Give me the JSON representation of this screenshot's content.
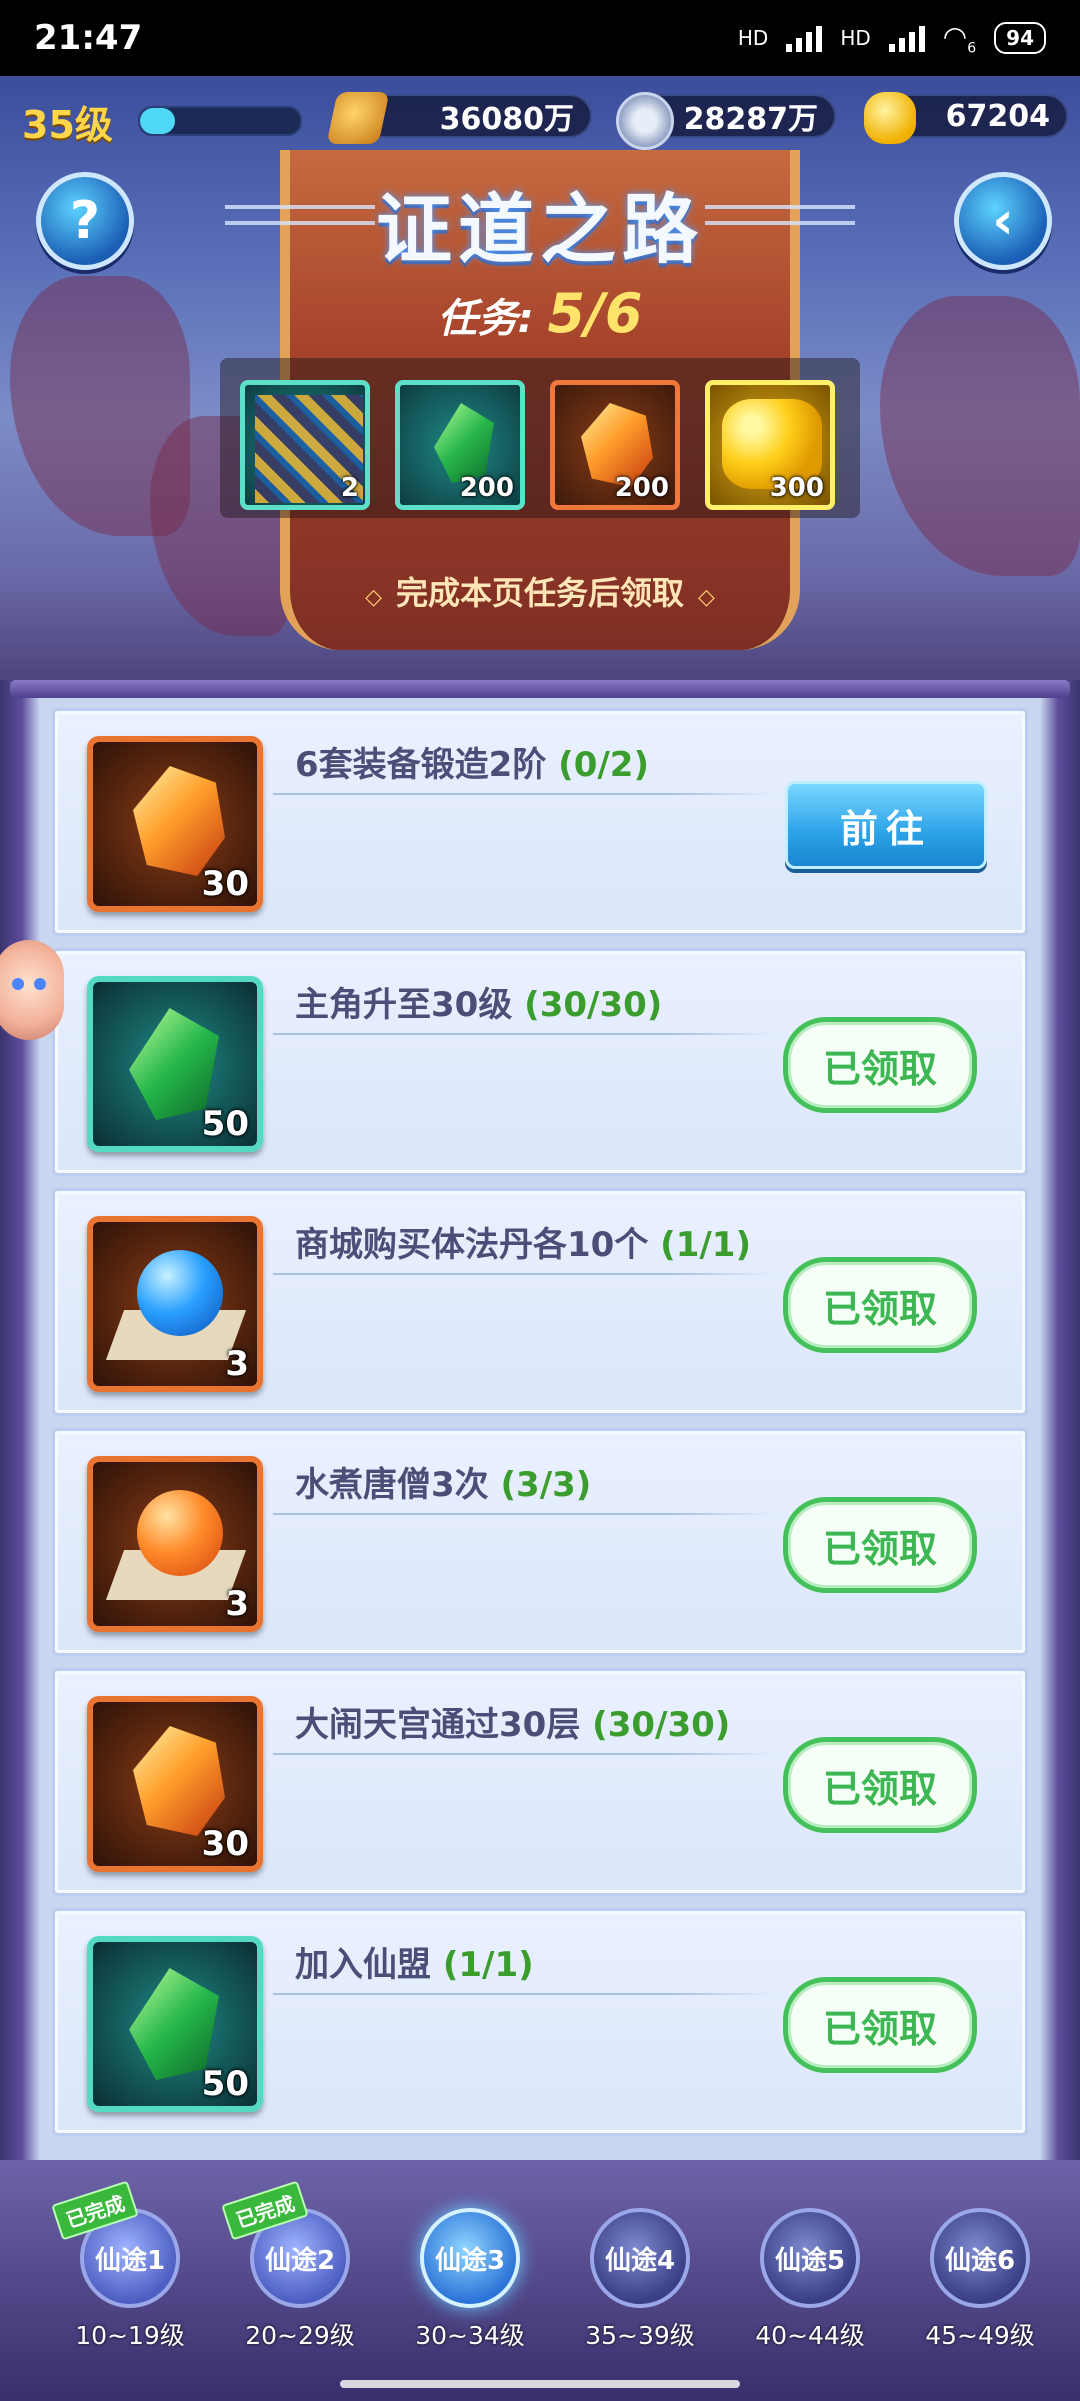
{
  "status_bar": {
    "time": "21:47",
    "hd1": "HD",
    "hd2": "HD",
    "wifi_sub": "6",
    "battery": "94"
  },
  "player": {
    "level": "35级"
  },
  "resources": {
    "power": "36080万",
    "coins": "28287万",
    "gold": "67204"
  },
  "header": {
    "title": "证道之路",
    "task_label": "任务:",
    "task_progress": "5/6",
    "claim_hint": "完成本页任务后领取"
  },
  "rewards": [
    {
      "icon": "armor-set-icon",
      "count": "2"
    },
    {
      "icon": "green-gem-icon",
      "count": "200"
    },
    {
      "icon": "orange-stone-icon",
      "count": "200"
    },
    {
      "icon": "gold-ingot-icon",
      "count": "300"
    }
  ],
  "tasks": [
    {
      "name": "6套装备锻造2阶",
      "progress": "(0/2)",
      "reward_icon": "orange-stone-icon",
      "reward_count": "30",
      "button": "前往",
      "state": "go"
    },
    {
      "name": "主角升至30级",
      "progress": "(30/30)",
      "reward_icon": "green-gem-icon",
      "reward_count": "50",
      "button": "已领取",
      "state": "claimed"
    },
    {
      "name": "商城购买体法丹各10个",
      "progress": "(1/1)",
      "reward_icon": "blue-pill-icon",
      "reward_count": "3",
      "button": "已领取",
      "state": "claimed"
    },
    {
      "name": "水煮唐僧3次",
      "progress": "(3/3)",
      "reward_icon": "orange-pill-icon",
      "reward_count": "3",
      "button": "已领取",
      "state": "claimed"
    },
    {
      "name": "大闹天宫通过30层",
      "progress": "(30/30)",
      "reward_icon": "orange-stone-icon",
      "reward_count": "30",
      "button": "已领取",
      "state": "claimed"
    },
    {
      "name": "加入仙盟",
      "progress": "(1/1)",
      "reward_icon": "green-gem-icon",
      "reward_count": "50",
      "button": "已领取",
      "state": "claimed"
    }
  ],
  "nav": [
    {
      "label": "仙途1",
      "range": "10~19级",
      "tag": "已完成"
    },
    {
      "label": "仙途2",
      "range": "20~29级",
      "tag": "已完成"
    },
    {
      "label": "仙途3",
      "range": "30~34级",
      "tag": ""
    },
    {
      "label": "仙途4",
      "range": "35~39级",
      "tag": ""
    },
    {
      "label": "仙途5",
      "range": "40~44级",
      "tag": ""
    },
    {
      "label": "仙途6",
      "range": "45~49级",
      "tag": ""
    }
  ],
  "colors": {
    "accent_green": "#3db653",
    "accent_blue": "#2ba2e8",
    "gold": "#ffe36a"
  }
}
